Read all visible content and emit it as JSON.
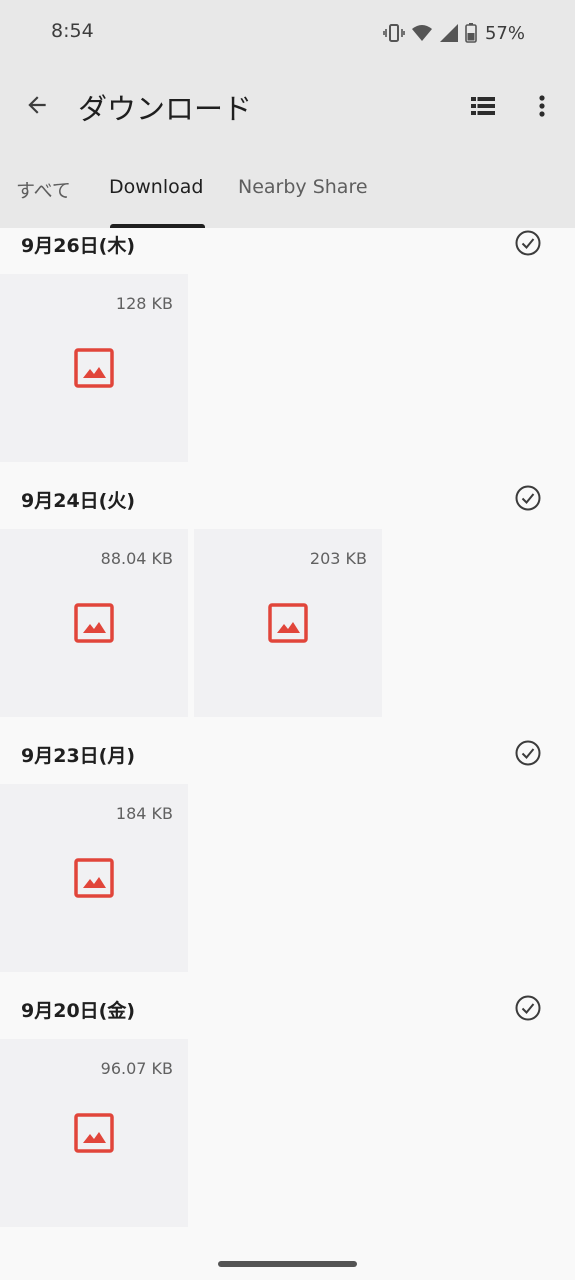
{
  "status_bar": {
    "time": "8:54",
    "battery": "57%"
  },
  "toolbar": {
    "title": "ダウンロード"
  },
  "tabs": [
    {
      "label": "すべて"
    },
    {
      "label": "Download"
    },
    {
      "label": "Nearby Share"
    }
  ],
  "active_tab": "Download",
  "sections": [
    {
      "date": "9月26日(木)",
      "files": [
        {
          "size": "128 KB",
          "icon": "image-icon"
        }
      ]
    },
    {
      "date": "9月24日(火)",
      "files": [
        {
          "size": "88.04 KB",
          "icon": "image-icon"
        },
        {
          "size": "203 KB",
          "icon": "image-icon"
        }
      ]
    },
    {
      "date": "9月23日(月)",
      "files": [
        {
          "size": "184 KB",
          "icon": "image-icon"
        }
      ]
    },
    {
      "date": "9月20日(金)",
      "files": [
        {
          "size": "96.07 KB",
          "icon": "image-icon"
        }
      ]
    }
  ],
  "colors": {
    "appbar": "#e8e8e8",
    "background": "#f9f9f9",
    "tile": "#f1f1f3",
    "image_icon": "#e1453a"
  }
}
